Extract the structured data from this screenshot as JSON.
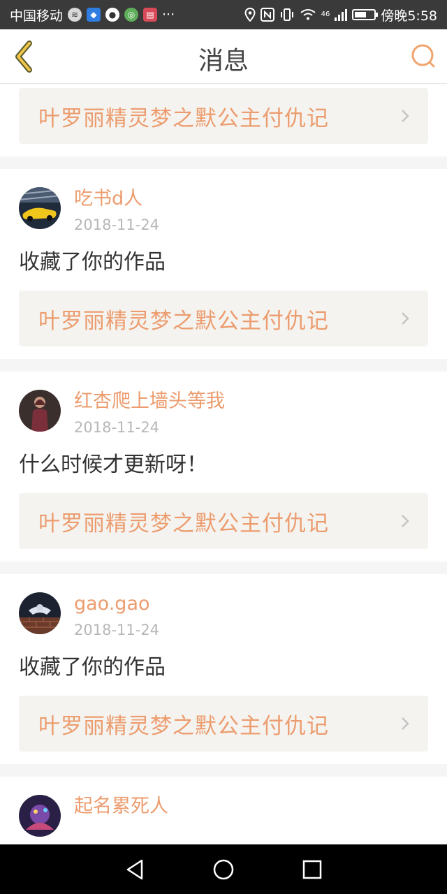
{
  "status_bar": {
    "carrier": "中国移动",
    "more": "···",
    "network": "46",
    "time_label": "傍晚5:58",
    "icons": [
      "sound-wave-icon",
      "shield-icon",
      "chat-icon",
      "browser-icon",
      "book-icon",
      "location-icon",
      "nfc-icon",
      "vibrate-icon",
      "wifi-icon",
      "signal-icon",
      "battery-icon"
    ]
  },
  "header": {
    "title": "消息",
    "back_icon": "chevron-left-icon",
    "search_icon": "search-icon",
    "accent": "#ec9c6e"
  },
  "messages": [
    {
      "username": "",
      "date": "",
      "text": "",
      "work_title": "叶罗丽精灵梦之默公主付仇记"
    },
    {
      "username": "吃书d人",
      "date": "2018-11-24",
      "text": "收藏了你的作品",
      "work_title": "叶罗丽精灵梦之默公主付仇记"
    },
    {
      "username": "红杏爬上墙头等我",
      "date": "2018-11-24",
      "text": "什么时候才更新呀！",
      "work_title": "叶罗丽精灵梦之默公主付仇记"
    },
    {
      "username": "gao.gao",
      "date": "2018-11-24",
      "text": "收藏了你的作品",
      "work_title": "叶罗丽精灵梦之默公主付仇记"
    },
    {
      "username": "起名累死人",
      "date": "",
      "text": "",
      "work_title": ""
    }
  ],
  "nav_bar": {
    "icons": [
      "back-triangle-icon",
      "home-circle-icon",
      "recents-square-icon"
    ]
  }
}
